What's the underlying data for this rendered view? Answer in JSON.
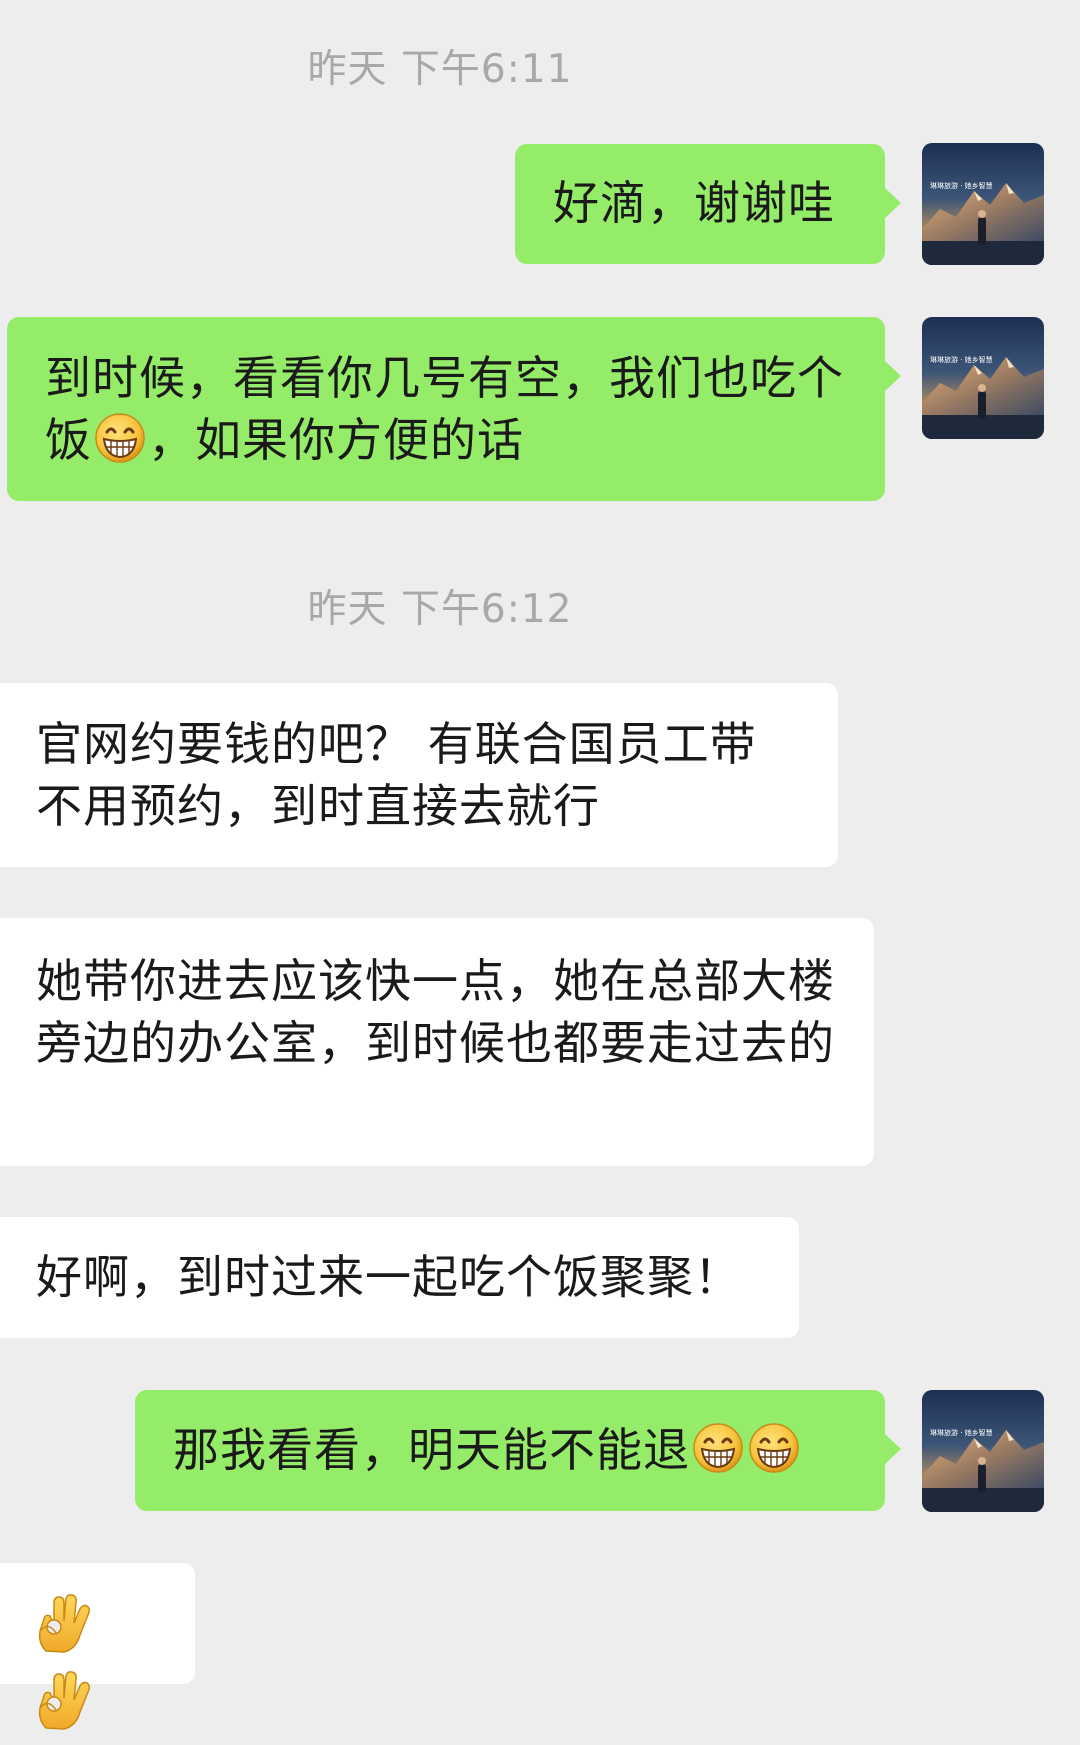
{
  "timestamps": [
    "昨天 下午6:11",
    "昨天 下午6:12"
  ],
  "messages": [
    {
      "side": "sent",
      "text": "好滴，谢谢哇"
    },
    {
      "side": "sent",
      "text_a": "到时候，看看你几号有空，我们也吃个饭",
      "emoji": "grin-emoji",
      "text_b": "，如果你方便的话"
    },
    {
      "side": "received",
      "text": "官网约要钱的吧？ 有联合国员工带不用预约，到时直接去就行"
    },
    {
      "side": "received",
      "text": "她带你进去应该快一点，她在总部大楼旁边的办公室，到时候也都要走过去的"
    },
    {
      "side": "received",
      "text": "好啊，到时过来一起吃个饭聚聚！"
    },
    {
      "side": "sent",
      "text": "那我看看，明天能不能退",
      "emojis": [
        "grin-emoji",
        "grin-emoji"
      ]
    },
    {
      "side": "received",
      "emojis": [
        "ok-hand-emoji",
        "ok-hand-emoji"
      ]
    }
  ],
  "avatar": {
    "caption": "琳琳旅游 · 她乡智慧",
    "icon": "mountain-landscape-avatar"
  },
  "colors": {
    "background": "#ededed",
    "sent_bubble": "#95ec69",
    "received_bubble": "#ffffff",
    "timestamp_text": "#a8a8a8"
  }
}
